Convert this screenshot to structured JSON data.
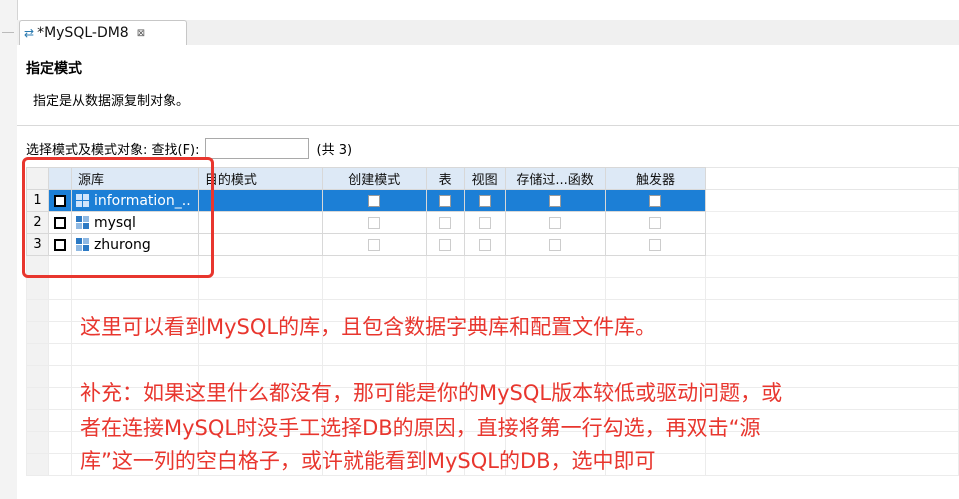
{
  "tab": {
    "title": "*MySQL-DM8",
    "icon": "transfer-icon",
    "close": "⊠"
  },
  "header": {
    "title": "指定模式",
    "description": "指定是从数据源复制对象。"
  },
  "search": {
    "label": "选择模式及模式对象: 查找(F):",
    "value": "",
    "count": "(共 3)"
  },
  "table": {
    "columns": [
      "源库",
      "目的模式",
      "创建模式",
      "表",
      "视图",
      "存储过...函数",
      "触发器"
    ],
    "rows": [
      {
        "num": "1",
        "name": "information_..",
        "selected": true
      },
      {
        "num": "2",
        "name": "mysql",
        "selected": false
      },
      {
        "num": "3",
        "name": "zhurong",
        "selected": false
      }
    ]
  },
  "annotation": {
    "line1": "这里可以看到MySQL的库，且包含数据字典库和配置文件库。",
    "line2": "补充：如果这里什么都没有，那可能是你的MySQL版本较低或驱动问题，或",
    "line3": "者在连接MySQL时没手工选择DB的原因，直接将第一行勾选，再双击“源",
    "line4": "库”这一列的空白格子，或许就能看到MySQL的DB，选中即可"
  },
  "colors": {
    "highlight": "#1c7fd6",
    "annotation_red": "#e8362e",
    "header_bg": "#dde9f6"
  }
}
